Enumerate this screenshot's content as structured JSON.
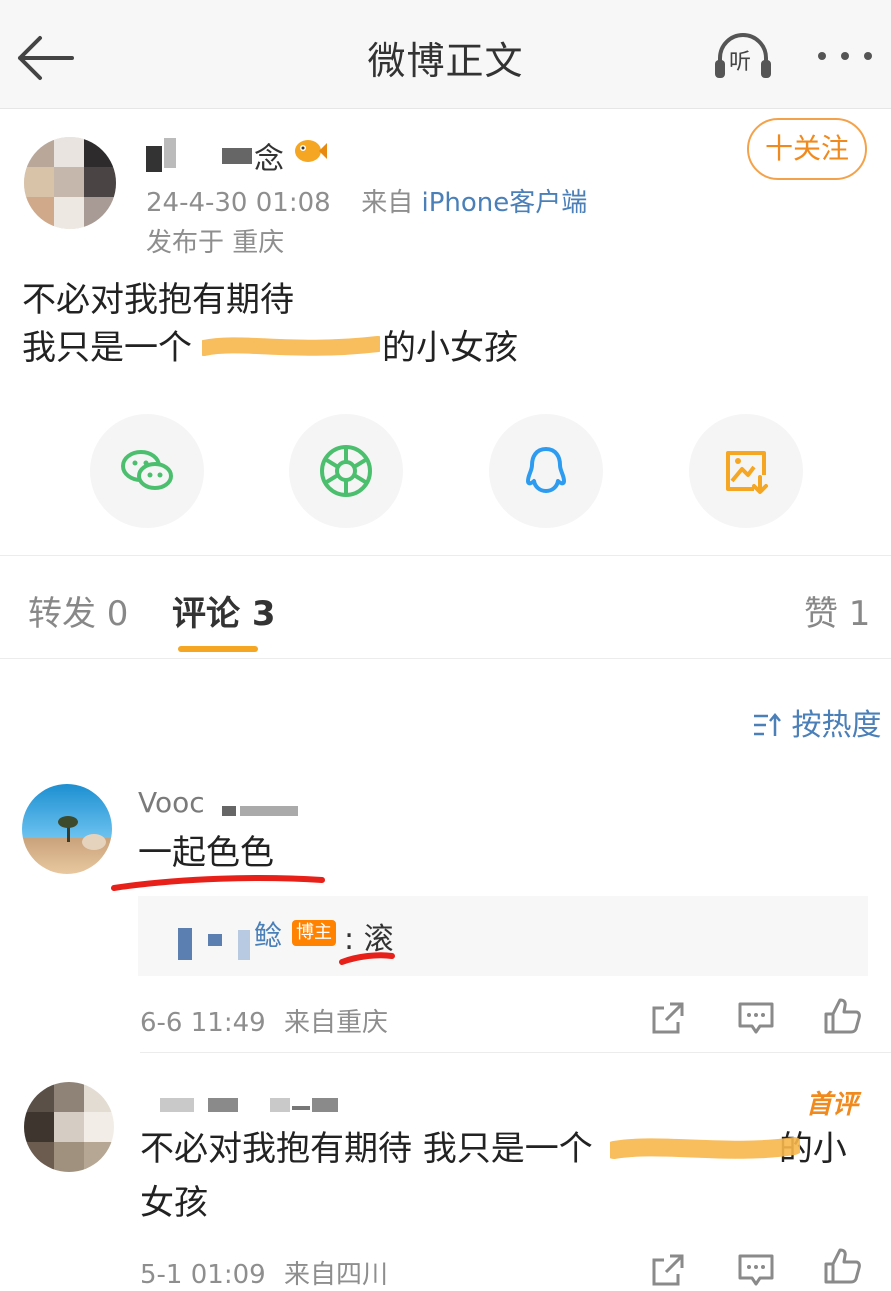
{
  "nav": {
    "title": "微博正文",
    "back_icon": "arrow-left-icon",
    "listen_label": "听",
    "more_icon": "more-dots-icon"
  },
  "post": {
    "author_name_visible": "念",
    "timestamp": "24-4-30 01:08",
    "from_label": "来自",
    "client": "iPhone客户端",
    "location": "发布于 重庆",
    "follow_label": "十关注",
    "text_line1": "不必对我抱有期待",
    "text_line2_prefix": "我只是一个",
    "text_line2_suffix": "的小女孩"
  },
  "share": [
    {
      "icon": "wechat-icon",
      "color": "#4cbf6e"
    },
    {
      "icon": "moments-icon",
      "color": "#4cbf6e"
    },
    {
      "icon": "qq-icon",
      "color": "#2d9cf0"
    },
    {
      "icon": "save-image-icon",
      "color": "#f5a623"
    }
  ],
  "tabs": {
    "repost": "转发 0",
    "comments": "评论 3",
    "likes": "赞 1"
  },
  "sort_label": "按热度",
  "comments": [
    {
      "name_visible": "Vooc",
      "text": "一起色色",
      "reply": {
        "name_visible": "鲶",
        "badge": "博主",
        "text": ": 滚"
      },
      "time": "6-6 11:49",
      "source": "来自重庆"
    },
    {
      "first_badge": "首评",
      "text_line1_prefix": "不必对我抱有期待 我只是一个",
      "text_line1_suffix": "的小",
      "text_line2": "女孩",
      "time": "5-1 01:09",
      "source": "来自四川"
    }
  ],
  "colors": {
    "accent_orange": "#f5a623",
    "link_blue": "#4a7fb8",
    "annotation_red": "#e8201a"
  }
}
